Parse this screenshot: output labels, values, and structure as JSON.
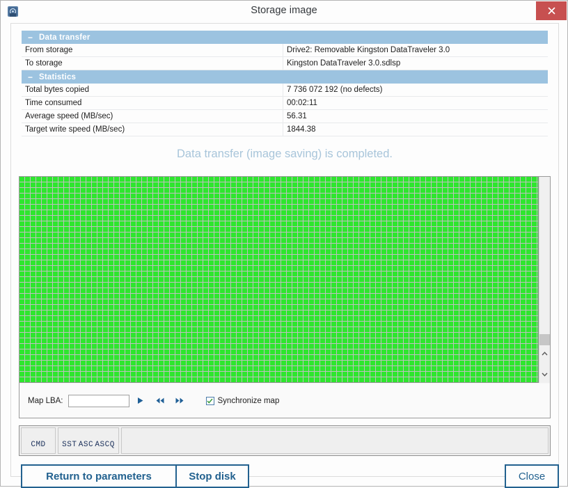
{
  "window": {
    "title": "Storage image",
    "app_icon": "disk-app-icon",
    "close_icon": "close-icon"
  },
  "sections": [
    {
      "id": "data-transfer",
      "title": "Data transfer",
      "collapse_glyph": "−",
      "rows": [
        {
          "label": "From storage",
          "value": "Drive2: Removable Kingston DataTraveler 3.0"
        },
        {
          "label": "To storage",
          "value": "Kingston DataTraveler 3.0.sdlsp"
        }
      ]
    },
    {
      "id": "statistics",
      "title": "Statistics",
      "collapse_glyph": "−",
      "rows": [
        {
          "label": "Total bytes copied",
          "value": "7 736 072 192 (no defects)"
        },
        {
          "label": "Time consumed",
          "value": "00:02:11"
        },
        {
          "label": "Average speed (MB/sec)",
          "value": "56.31"
        },
        {
          "label": "Target write speed (MB/sec)",
          "value": "1844.38"
        }
      ]
    }
  ],
  "status": {
    "message": "Data transfer (image saving) is completed.",
    "color": "#a8c5da"
  },
  "map": {
    "cell_color": "#2ee62e",
    "background_color": "#c0c0c0",
    "columns": 104,
    "full_rows": 41,
    "last_row_filled": 62,
    "scrollbar": {
      "up_glyph": "⌃",
      "down_glyph": "⌄"
    },
    "toolbar": {
      "lba_label": "Map LBA:",
      "lba_value": "",
      "lba_placeholder": "",
      "play_icon": "play-icon",
      "rewind_icon": "rewind-icon",
      "forward_icon": "fast-forward-icon",
      "sync_label": "Synchronize map",
      "sync_checked": true
    }
  },
  "cmd_strip": {
    "cmd_label": "CMD",
    "sst_label": "SST",
    "asc_label": "ASC",
    "ascq_label": "ASCQ",
    "detail_text": ""
  },
  "buttons": {
    "return": "Return to parameters",
    "stop": "Stop disk",
    "close": "Close",
    "accent": "#22618f"
  }
}
